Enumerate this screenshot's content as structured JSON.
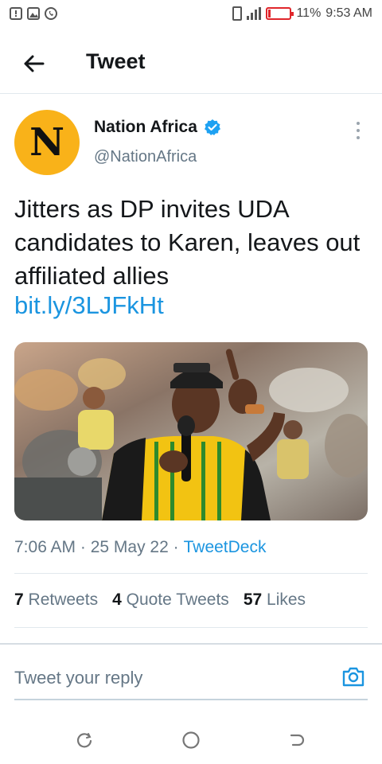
{
  "status_bar": {
    "battery": "11%",
    "battery_level": 0.11,
    "time": "9:53 AM",
    "left_icons": [
      "sim-alert-icon",
      "gallery-icon",
      "whatsapp-icon"
    ],
    "right_icons": [
      "vibrate-icon",
      "signal-icon",
      "battery-icon"
    ],
    "battery_color": "#e0262b"
  },
  "header": {
    "title": "Tweet",
    "back_icon": "arrow-left-icon"
  },
  "tweet": {
    "author_name": "Nation Africa",
    "author_handle": "@NationAfrica",
    "avatar_letter": "N",
    "avatar_color": "#f9b219",
    "verified_color": "#1da1f2",
    "text": "Jitters as DP invites UDA candidates to Karen, leaves out affiliated allies",
    "link": "bit.ly/3LJFkHt",
    "link_color": "#1b95e0",
    "timestamp": "7:06 AM · 25 May 22 ·",
    "source": "TweetDeck"
  },
  "stats": {
    "retweets_count": "7",
    "retweets_label": "Retweets",
    "quotes_count": "4",
    "quotes_label": "Quote Tweets",
    "likes_count": "57",
    "likes_label": "Likes"
  },
  "reply": {
    "placeholder": "Tweet your reply",
    "camera_icon": "camera-icon"
  },
  "navbar": {
    "icons": [
      "recent-apps-icon",
      "home-circle-icon",
      "back-nav-icon"
    ]
  }
}
